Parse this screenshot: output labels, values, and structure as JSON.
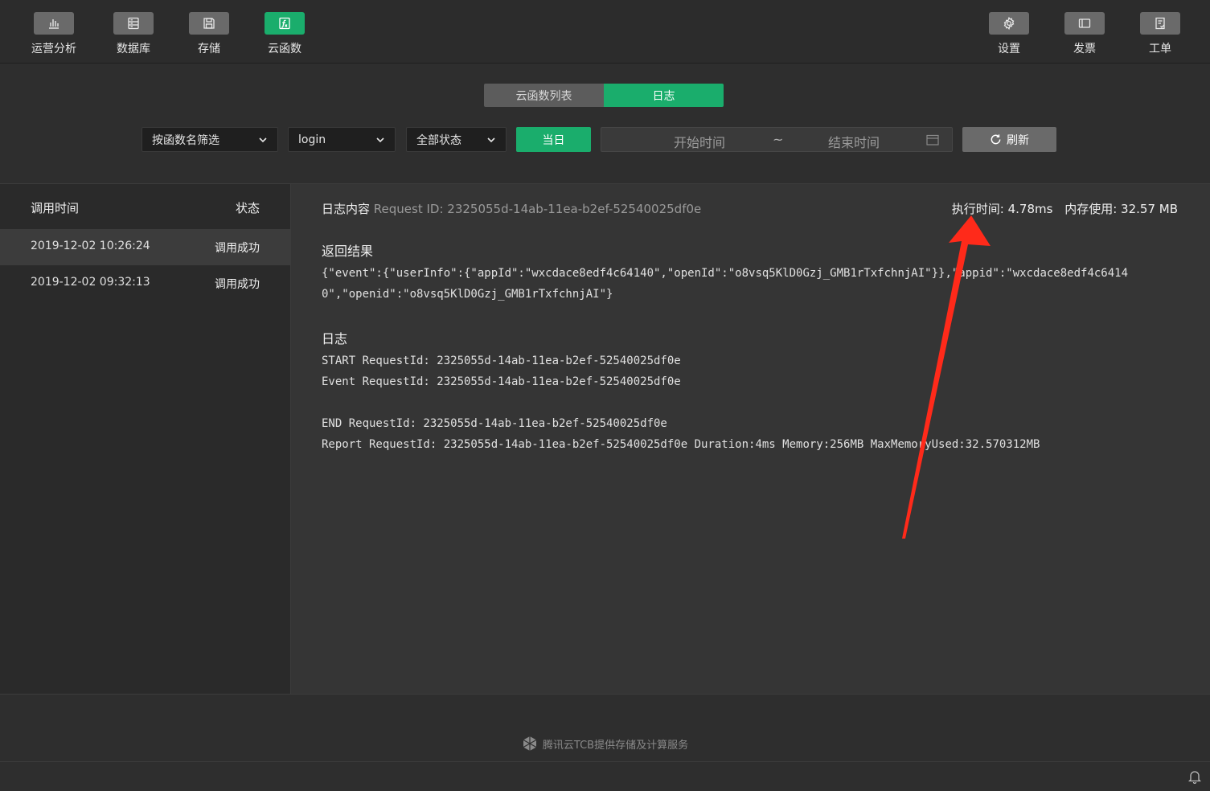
{
  "toolbar": {
    "left": [
      {
        "label": "运营分析",
        "icon": "bar-chart-icon"
      },
      {
        "label": "数据库",
        "icon": "database-icon"
      },
      {
        "label": "存储",
        "icon": "save-icon"
      },
      {
        "label": "云函数",
        "icon": "function-icon",
        "active": true
      }
    ],
    "right": [
      {
        "label": "设置",
        "icon": "gear-icon"
      },
      {
        "label": "发票",
        "icon": "invoice-icon"
      },
      {
        "label": "工单",
        "icon": "ticket-icon"
      }
    ]
  },
  "tabs": {
    "list": "云函数列表",
    "log": "日志"
  },
  "filters": {
    "function_filter": "按函数名筛选",
    "function_name": "login",
    "status": "全部状态",
    "today": "当日",
    "start_placeholder": "开始时间",
    "separator": "~",
    "end_placeholder": "结束时间",
    "refresh": "刷新"
  },
  "list": {
    "col_time": "调用时间",
    "col_status": "状态",
    "rows": [
      {
        "time": "2019-12-02 10:26:24",
        "status": "调用成功"
      },
      {
        "time": "2019-12-02 09:32:13",
        "status": "调用成功"
      }
    ]
  },
  "detail": {
    "title": "日志内容",
    "request_id": "Request ID: 2325055d-14ab-11ea-b2ef-52540025df0e",
    "exec_time": "执行时间: 4.78ms",
    "memory": "内存使用: 32.57 MB",
    "result_title": "返回结果",
    "result_line1": "{\"event\":{\"userInfo\":{\"appId\":\"wxcdace8edf4c64140\",\"openId\":\"o8vsq5KlD0Gzj_GMB1rTxfchnjAI\"}},\"appid\":\"wxcdace8edf4c6414",
    "result_line2": "0\",\"openid\":\"o8vsq5KlD0Gzj_GMB1rTxfchnjAI\"}",
    "log_title": "日志",
    "log_lines": [
      "START RequestId: 2325055d-14ab-11ea-b2ef-52540025df0e",
      "Event RequestId: 2325055d-14ab-11ea-b2ef-52540025df0e",
      "",
      "END RequestId: 2325055d-14ab-11ea-b2ef-52540025df0e",
      "Report RequestId: 2325055d-14ab-11ea-b2ef-52540025df0e Duration:4ms Memory:256MB MaxMemoryUsed:32.570312MB"
    ]
  },
  "footer": {
    "text": "腾讯云TCB提供存储及计算服务"
  },
  "colors": {
    "accent": "#1aad6c",
    "annotation": "#ff2a1a"
  }
}
